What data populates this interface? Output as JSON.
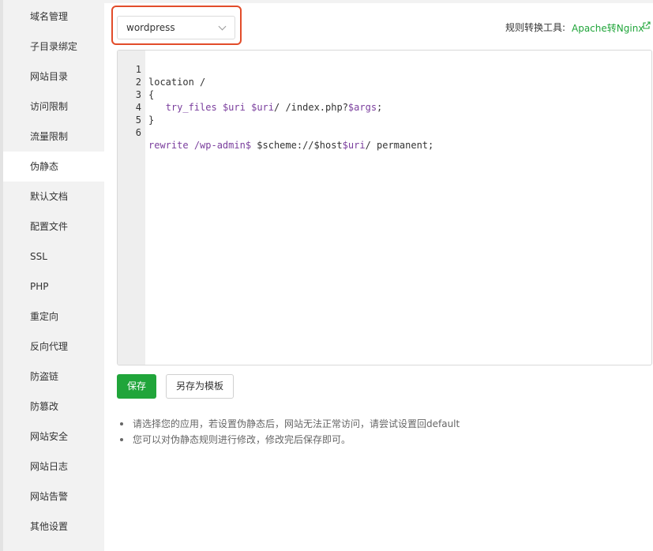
{
  "sidebar": {
    "items": [
      {
        "label": "域名管理"
      },
      {
        "label": "子目录绑定"
      },
      {
        "label": "网站目录"
      },
      {
        "label": "访问限制"
      },
      {
        "label": "流量限制"
      },
      {
        "label": "伪静态"
      },
      {
        "label": "默认文档"
      },
      {
        "label": "配置文件"
      },
      {
        "label": "SSL"
      },
      {
        "label": "PHP"
      },
      {
        "label": "重定向"
      },
      {
        "label": "反向代理"
      },
      {
        "label": "防盗链"
      },
      {
        "label": "防篡改"
      },
      {
        "label": "网站安全"
      },
      {
        "label": "网站日志"
      },
      {
        "label": "网站告警"
      },
      {
        "label": "其他设置"
      }
    ],
    "active_index": 5
  },
  "template_select": {
    "value": "wordpress"
  },
  "converter": {
    "label": "规则转换工具:",
    "link_text": "Apache转Nginx",
    "link_icon": "external-link-icon"
  },
  "editor": {
    "lines": [
      {
        "num": "1",
        "code": "location /"
      },
      {
        "num": "2",
        "code": "{"
      },
      {
        "num": "3",
        "code": "   try_files $uri $uri/ /index.php?$args;"
      },
      {
        "num": "4",
        "code": "}"
      },
      {
        "num": "5",
        "code": ""
      },
      {
        "num": "6",
        "code": "rewrite /wp-admin$ $scheme://$host$uri/ permanent;"
      }
    ]
  },
  "buttons": {
    "save": "保存",
    "save_as_template": "另存为模板"
  },
  "tips": [
    "请选择您的应用，若设置伪静态后，网站无法正常访问，请尝试设置回default",
    "您可以对伪静态规则进行修改，修改完后保存即可。"
  ],
  "colors": {
    "accent_green": "#20a53a",
    "highlight_red": "#e24c2a",
    "keyword_purple": "#7a3e9d"
  }
}
